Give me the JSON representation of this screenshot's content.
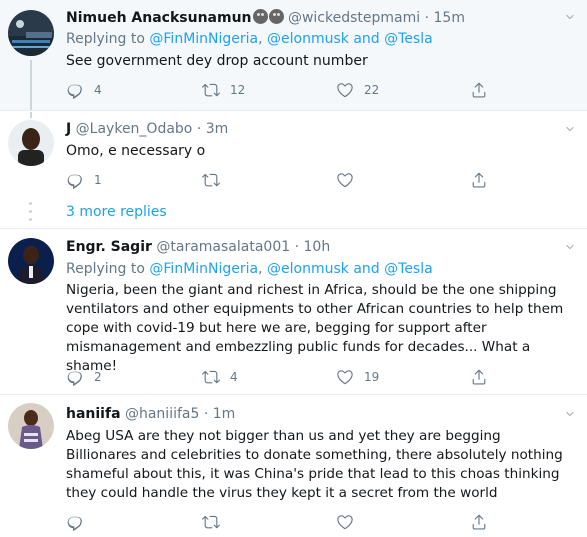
{
  "tweets": [
    {
      "name": "Nimueh Anacksunamun",
      "handle": "@wickedstepmami",
      "time": "15m",
      "reply_prefix": "Replying to",
      "mentions": [
        "@FinMinNigeria",
        "@elonmusk",
        "@Tesla"
      ],
      "mention_sep": ", ",
      "mention_and": " and ",
      "text": "See government dey drop account number",
      "replies": "4",
      "retweets": "12",
      "likes": "22"
    },
    {
      "name": "J",
      "handle": "@Layken_Odabo",
      "time": "3m",
      "text": "Omo, e necessary o",
      "replies": "1",
      "retweets": "",
      "likes": ""
    },
    {
      "name": "Engr. Sagir",
      "handle": "@taramasalata001",
      "time": "10h",
      "reply_prefix": "Replying to",
      "mentions": [
        "@FinMinNigeria",
        "@elonmusk",
        "@Tesla"
      ],
      "mention_sep": ", ",
      "mention_and": " and ",
      "text": "Nigeria, been the giant and richest in Africa, should be the one shipping ventilators and other equipments to other African countries to help them cope with covid-19 but here we are, begging for support after mismanagement and embezzling public funds for decades... What a shame!",
      "replies": "2",
      "retweets": "4",
      "likes": "19"
    },
    {
      "name": "haniifa",
      "handle": "@haniiifa5",
      "time": "1m",
      "text": "Abeg USA are they not bigger than us and yet they are begging Billionares and celebrities to donate something, there absolutely nothing shameful about this, it was China's pride that lead to this choas thinking they could handle the virus they kept it a secret from the world",
      "replies": "",
      "retweets": "",
      "likes": ""
    }
  ],
  "show_more": "3 more replies",
  "time_sep": " · ",
  "icons": [
    "reply-icon",
    "retweet-icon",
    "like-icon",
    "share-icon",
    "chevron-down-icon"
  ],
  "colors": {
    "accent": "#1da1f2",
    "muted": "#657786",
    "highlight_bg": "#f5f8fa"
  }
}
